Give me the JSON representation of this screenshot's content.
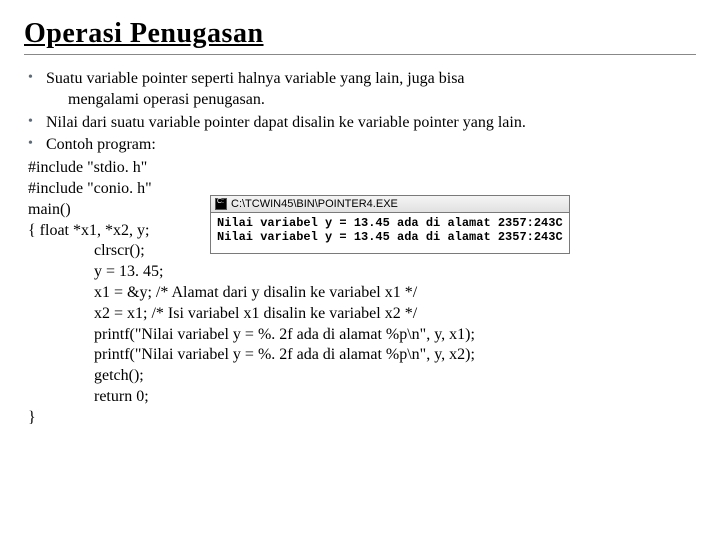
{
  "title": "Operasi Penugasan",
  "bullets": [
    "Suatu variable pointer seperti halnya variable yang lain, juga bisa",
    "Nilai dari suatu variable pointer dapat disalin ke variable pointer yang lain.",
    "Contoh program:"
  ],
  "bullet1_cont": "mengalami operasi penugasan.",
  "code": {
    "l1": "#include \"stdio. h\"",
    "l2": "#include \"conio. h\"",
    "l3": "main()",
    "l4": "{ float *x1, *x2, y;",
    "l5": "clrscr();",
    "l6": "y = 13. 45;",
    "l7": "x1 = &y;             /* Alamat dari y disalin ke variabel x1 */",
    "l8": "x2 = x1;               /* Isi variabel x1 disalin ke variabel x2 */",
    "l9": "printf(\"Nilai variabel y = %. 2f ada di alamat %p\\n\", y, x1);",
    "l10": "printf(\"Nilai variabel y = %. 2f ada di alamat %p\\n\", y, x2);",
    "l11": "getch();",
    "l12": "return 0;",
    "l13": "}"
  },
  "console": {
    "title": "C:\\TCWIN45\\BIN\\POINTER4.EXE",
    "line1": "Nilai variabel y = 13.45 ada di alamat 2357:243C",
    "line2": "Nilai variabel y = 13.45 ada di alamat 2357:243C"
  }
}
